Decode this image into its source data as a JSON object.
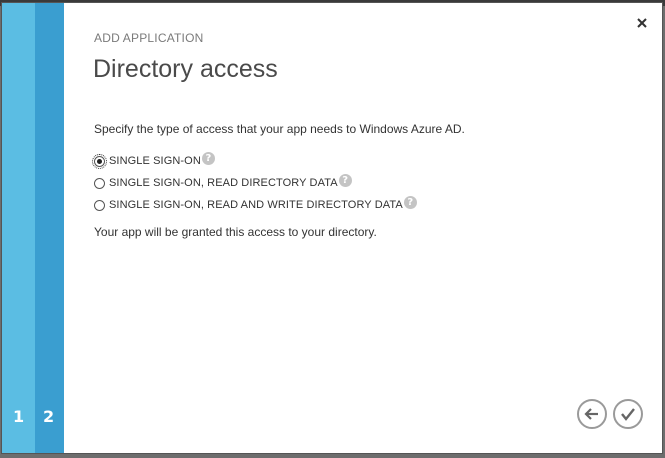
{
  "dialog": {
    "kicker": "ADD APPLICATION",
    "title": "Directory access",
    "description": "Specify the type of access that your app needs to Windows Azure AD.",
    "note": "Your app will be granted this access to your directory."
  },
  "steps": [
    "1",
    "2"
  ],
  "options": [
    {
      "label": "SINGLE SIGN-ON",
      "checked": true
    },
    {
      "label": "SINGLE SIGN-ON, READ DIRECTORY DATA",
      "checked": false
    },
    {
      "label": "SINGLE SIGN-ON, READ AND WRITE DIRECTORY DATA",
      "checked": false
    }
  ],
  "icons": {
    "close": "close-icon",
    "help": "help-icon",
    "back": "back-arrow-icon",
    "finish": "checkmark-icon"
  },
  "colors": {
    "rail_light": "#5bbde3",
    "rail_dark": "#3a9ed0",
    "overlay": "#6d6d6d"
  }
}
